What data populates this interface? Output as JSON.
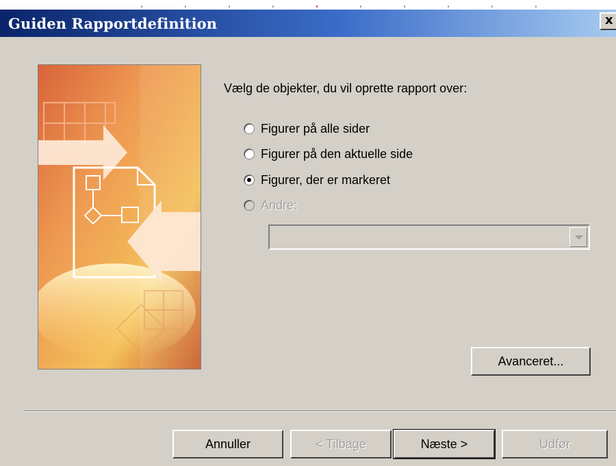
{
  "window": {
    "title": "Guiden Rapportdefinition",
    "close_glyph": "x"
  },
  "prompt": "Vælg de objekter, du vil oprette rapport over:",
  "options": [
    {
      "label": "Figurer på alle sider",
      "checked": false,
      "enabled": true
    },
    {
      "label": "Figurer på den aktuelle side",
      "checked": false,
      "enabled": true
    },
    {
      "label": "Figurer, der er markeret",
      "checked": true,
      "enabled": true
    },
    {
      "label": "Andre:",
      "checked": false,
      "enabled": false
    }
  ],
  "dropdown": {
    "value": "",
    "enabled": false
  },
  "buttons": {
    "advanced": "Avanceret...",
    "cancel": "Annuller",
    "back": "< Tilbage",
    "next": "Næste >",
    "finish": "Udfør"
  },
  "colors": {
    "title_start": "#0a246a",
    "title_end": "#a6caf0",
    "face": "#d4d0c8",
    "art_orange": "#e08540"
  }
}
